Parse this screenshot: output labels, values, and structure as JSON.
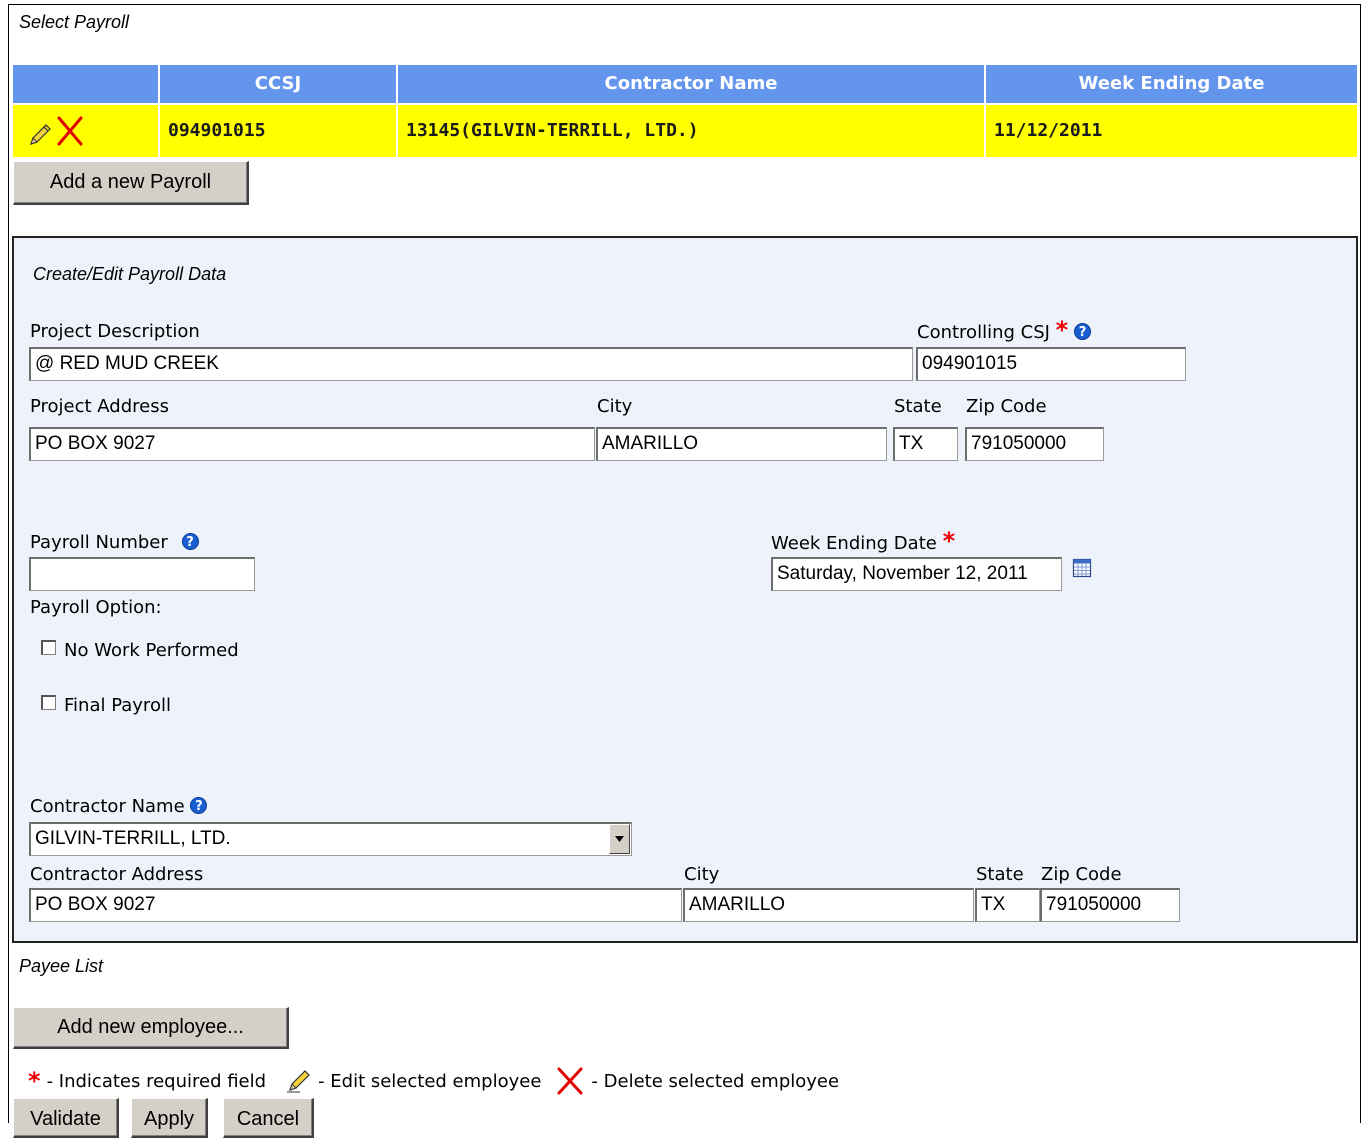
{
  "select_payroll": {
    "caption": "Select Payroll",
    "columns": [
      "CCSJ",
      "Contractor Name",
      "Week Ending Date"
    ],
    "rows": [
      {
        "ccsj": "094901015",
        "contractor_name": "13145(GILVIN-TERRILL, LTD.)",
        "week_ending_date": "11/12/2011"
      }
    ],
    "add_button": "Add a new Payroll"
  },
  "edit": {
    "caption": "Create/Edit Payroll Data",
    "project_description": {
      "label": "Project Description",
      "value": "@ RED MUD CREEK"
    },
    "controlling_csj": {
      "label": "Controlling CSJ",
      "value": "094901015"
    },
    "project_address": {
      "label": "Project Address",
      "value": "PO BOX 9027"
    },
    "city": {
      "label": "City",
      "value": "AMARILLO"
    },
    "state": {
      "label": "State",
      "value": "TX"
    },
    "zip": {
      "label": "Zip Code",
      "value": "791050000"
    },
    "payroll_number": {
      "label": "Payroll Number",
      "value": ""
    },
    "week_ending": {
      "label": "Week Ending Date",
      "value": "Saturday, November 12, 2011"
    },
    "payroll_option": {
      "label": "Payroll Option:",
      "no_work": "No Work Performed",
      "final": "Final Payroll"
    },
    "contractor_name": {
      "label": "Contractor Name",
      "value": "GILVIN-TERRILL, LTD."
    },
    "contractor_address": {
      "label": "Contractor Address",
      "value": "PO BOX 9027"
    },
    "contractor_city": {
      "label": "City",
      "value": "AMARILLO"
    },
    "contractor_state": {
      "label": "State",
      "value": "TX"
    },
    "contractor_zip": {
      "label": "Zip Code",
      "value": "791050000"
    }
  },
  "payee": {
    "caption": "Payee List",
    "add_button": "Add new employee...",
    "legend_required": "- Indicates required field",
    "legend_edit": "- Edit selected employee",
    "legend_delete": "- Delete selected employee"
  },
  "actions": {
    "validate": "Validate",
    "apply": "Apply",
    "cancel": "Cancel"
  },
  "symbols": {
    "required": "*",
    "help": "?"
  },
  "colors": {
    "header_bg": "#6495ed",
    "selected_row": "#ffff00",
    "panel_bg": "#eef3fb",
    "required": "#ee0000"
  },
  "icons": [
    "pencil-icon",
    "delete-x-icon",
    "help-icon",
    "calendar-icon",
    "dropdown-arrow-icon"
  ]
}
